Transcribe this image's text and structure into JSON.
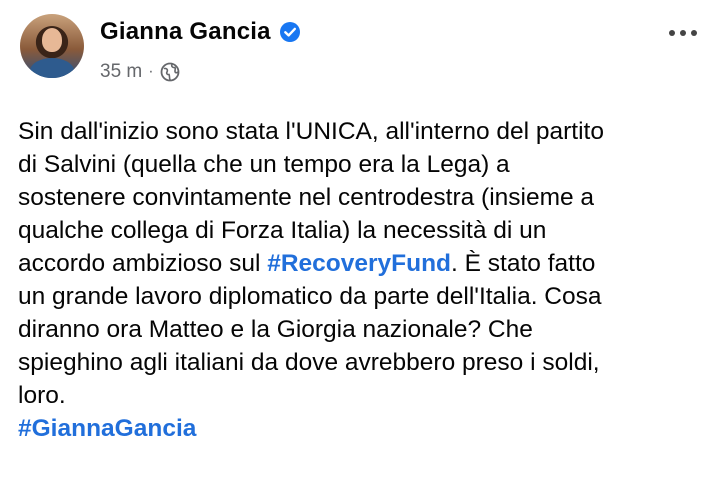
{
  "author": {
    "name": "Gianna Gancia",
    "verified": true
  },
  "meta": {
    "time": "35 m",
    "separator": "·",
    "audience_icon": "globe-icon"
  },
  "more_icon": "more-dots-icon",
  "post": {
    "line1": "Sin dall'inizio sono stata l'UNICA, all'interno del partito",
    "line2": "di Salvini (quella che un tempo era la Lega) a",
    "line3": "sostenere convintamente nel centrodestra (insieme a",
    "line4": "qualche collega di Forza Italia) la necessità di un",
    "line5_before": "accordo ambizioso sul ",
    "hashtag1": "#RecoveryFund",
    "line5_after": ". È stato fatto",
    "line6": "un grande lavoro diplomatico da parte dell'Italia. Cosa",
    "line7": "diranno ora Matteo e la Giorgia nazionale? Che",
    "line8": "spieghino agli italiani da dove avrebbero preso i soldi,",
    "line9": "loro.",
    "hashtag2": "#GiannaGancia"
  },
  "colors": {
    "hashtag": "#216fdb",
    "verified_badge": "#1877f2",
    "meta_text": "#65676b"
  }
}
